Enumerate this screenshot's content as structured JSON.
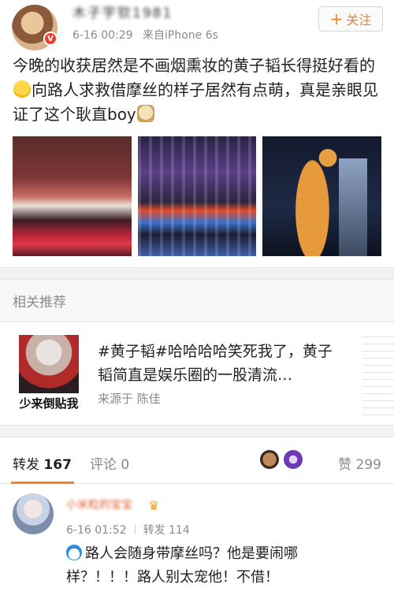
{
  "post": {
    "username": "木子宇钦1981",
    "vip_badge": "V",
    "time": "6-16 00:29",
    "source": "来自iPhone 6s",
    "follow_label": "关注",
    "text_part1": "今晚的收获居然是不画烟熏妆的黄子韬长得挺好看的",
    "text_part2": "向路人求救借摩丝的样子居然有点萌，真是亲眼见证了这个耿直boy",
    "photos": [
      "concert-stage-photo",
      "arena-lights-photo",
      "giraffe-sculpture-night-photo"
    ]
  },
  "recommend": {
    "section_title": "相关推荐",
    "thumb_caption": "少来倒贴我",
    "text": "#黄子韬#哈哈哈哈笑死我了，黄子韬简直是娱乐圈的一股清流…",
    "source": "来源于 陈佳"
  },
  "tabs": {
    "repost_label": "转发",
    "repost_count": "167",
    "comment_label": "评论",
    "comment_count": "0",
    "like_label": "赞",
    "like_count": "299"
  },
  "repost_item": {
    "name": "小米粒的宝宝",
    "time": "6-16 01:52",
    "repost_label": "转发 114",
    "text": "路人会随身带摩丝吗？他是要闹哪样？！！！路人别太宠他！不借！"
  },
  "colors": {
    "accent": "#f08228",
    "muted": "#8a8a8a"
  }
}
